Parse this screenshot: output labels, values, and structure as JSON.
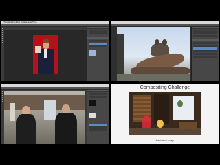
{
  "layout": "2x2 tutorial video grid",
  "panes": [
    {
      "id": "p1",
      "app": "Photoshop",
      "subject": "portrait on red background"
    },
    {
      "id": "p2",
      "app": "Photoshop",
      "subject": "tree stump with eagle sculpture"
    },
    {
      "id": "p3",
      "app": "Photoshop",
      "subject": "two men in front of building"
    },
    {
      "id": "p4",
      "app": "Slide",
      "subject": "library interior"
    }
  ],
  "app_menu": {
    "items": [
      "Photoshop",
      "File",
      "Edit",
      "Image",
      "Layer",
      "Type",
      "Select",
      "Filter",
      "3D",
      "View",
      "Window",
      "Help"
    ]
  },
  "slide": {
    "title": "Compositing Challenge",
    "caption": "Inspiration Image"
  },
  "colors": {
    "ps_dark": "#282828",
    "ps_panel": "#474747",
    "ps_menu": "#d8d8d8",
    "selection": "#5b8bc7",
    "portrait_bg": "#b3121a",
    "library_glow": "#e0283a"
  },
  "icons": [
    "tool-icons",
    "layer-thumb-icons"
  ]
}
